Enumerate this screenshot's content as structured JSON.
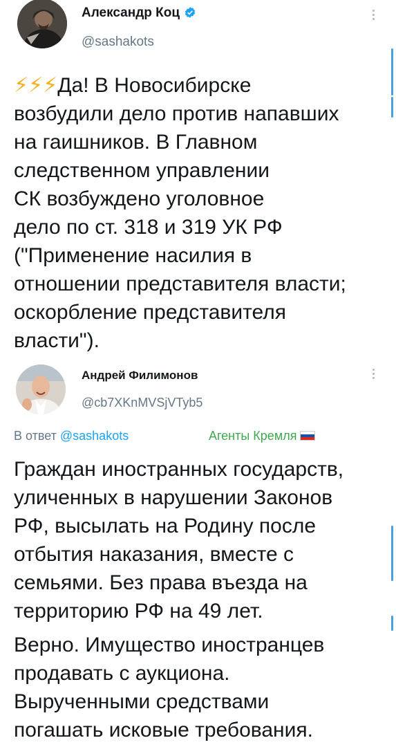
{
  "tweet1": {
    "author_name": "Александр Коц",
    "handle": "@sashakots",
    "bolts": "⚡⚡⚡",
    "text": "Да! В Новосибирске\nвозбудили дело против напавших\nна гаишников. В Главном\nследственном управлении\nСК возбуждено уголовное\nдело по ст. 318 и 319 УК РФ\n(\"Применение насилия в\nотношении представителя власти;\nоскорбление представителя\nвласти\")."
  },
  "tweet2": {
    "author_name": "Андрей Филимонов",
    "handle": "@cb7XKnMVSjVTyb5",
    "reply_prefix": "В ответ ",
    "reply_to": "@sashakots",
    "tag": "Агенты Кремля",
    "text": "Граждан иностранных государств,\nуличенных в нарушении Законов\nРФ, высылать на Родину после\nотбытия наказания, вместе с\nсемьями. Без права въезда на\nтерриторию РФ на 49 лет.",
    "text2": "Верно. Имущество иностранцев\nпродавать с аукциона.\nВырученными средствами\nпогашать исковые требования."
  },
  "colors": {
    "verified": "#1da1f2",
    "link": "#1da1f2",
    "tag": "#3fa84f",
    "bolt": "#f2b01e",
    "scrollbar": "#4a9fe0"
  },
  "icons": {
    "verified": "verified-badge-icon",
    "more": "more-vertical-icon",
    "flag": "russia-flag-icon"
  }
}
